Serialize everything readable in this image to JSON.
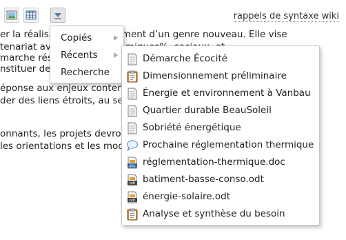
{
  "wiki_link": "rappels de syntaxe wiki",
  "doc_lines": [
    "er la réalisa                            % d’aménagement d’un genre nouveau. Elle vise",
    "tenariat ave                                                  acteurs économiques%, sociaux, et",
    "marche réso",
    "nstituer des",
    "",
    "éponse aux enjeux contemp",
    " der des liens étroits, au sens",
    "",
    "",
    "onnants, les projets devront",
    " les orientations et les mod",
    ""
  ],
  "menu_main": [
    {
      "label": "Copiés",
      "has_submenu": true
    },
    {
      "label": "Récents",
      "has_submenu": true
    },
    {
      "label": "Recherche",
      "has_submenu": false
    }
  ],
  "menu_recent": [
    {
      "label": "Démarche Écocité",
      "icon": "page-icon"
    },
    {
      "label": "Dimensionnement préliminaire",
      "icon": "clipboard-icon"
    },
    {
      "label": "Énergie et environnement à Vanbau",
      "icon": "page-icon"
    },
    {
      "label": "Quartier durable BeauSoleil",
      "icon": "page-icon"
    },
    {
      "label": "Sobriété énergétique",
      "icon": "page-icon"
    },
    {
      "label": "Prochaine réglementation thermique",
      "icon": "speech-bubble-icon"
    },
    {
      "label": "réglementation-thermique.doc",
      "icon": "doc-file-icon"
    },
    {
      "label": "batiment-basse-conso.odt",
      "icon": "odt-file-icon"
    },
    {
      "label": "énergie-solaire.odt",
      "icon": "odt-file-icon"
    },
    {
      "label": "Analyse et synthèse du besoin",
      "icon": "clipboard-icon"
    }
  ]
}
